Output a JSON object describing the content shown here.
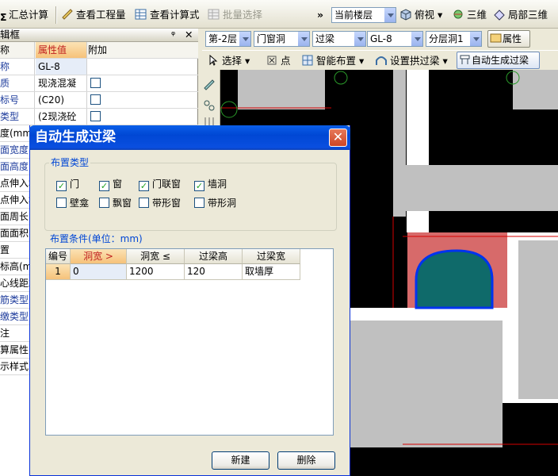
{
  "toolbar": {
    "summary_calc": "汇总计算",
    "view_quantity": "查看工程量",
    "view_formula": "查看计算式",
    "batch_select": "批量选择",
    "more": "»",
    "floor_select": "当前楼层",
    "view_mode": "俯视",
    "view_3d": "三维",
    "local_3d": "局部三维"
  },
  "toolbar2": {
    "floor": "第-2层",
    "category": "门窗洞",
    "element_type": "过梁",
    "element_name": "GL-8",
    "layer": "分层洞1",
    "property_btn": "属性",
    "select_btn": "选择",
    "point_btn": "点",
    "smart_layout_btn": "智能布置",
    "arch_beam_btn": "设置拱过梁",
    "auto_beam_btn": "自动生成过梁"
  },
  "left_panel": {
    "title": "辑框",
    "pin": "ᵠ",
    "close": "✕",
    "col_name": "称",
    "col_value": "属性值",
    "col_extra": "附加",
    "rows": [
      {
        "name": "称",
        "value": "GL-8",
        "check": false,
        "show_check": false,
        "blue": true
      },
      {
        "name": "质",
        "value": "现浇混凝",
        "check": false,
        "show_check": true,
        "blue": true
      },
      {
        "name": "标号",
        "value": "(C20)",
        "check": false,
        "show_check": true,
        "blue": true
      },
      {
        "name": "类型",
        "value": "(2现浇砼",
        "check": false,
        "show_check": true,
        "blue": true
      },
      {
        "name": "度(mm)",
        "value": "",
        "check": false,
        "show_check": false,
        "blue": false
      },
      {
        "name": "面宽度(",
        "value": "",
        "check": false,
        "show_check": false,
        "blue": true
      },
      {
        "name": "面高度(",
        "value": "",
        "check": false,
        "show_check": false,
        "blue": true
      },
      {
        "name": "点伸入墙",
        "value": "",
        "check": false,
        "show_check": false,
        "blue": false
      },
      {
        "name": "点伸入墙",
        "value": "",
        "check": false,
        "show_check": false,
        "blue": false
      },
      {
        "name": "面周长(",
        "value": "",
        "check": false,
        "show_check": false,
        "blue": false
      },
      {
        "name": "面面积(",
        "value": "",
        "check": false,
        "show_check": false,
        "blue": false
      },
      {
        "name": "置",
        "value": "",
        "check": false,
        "show_check": false,
        "blue": false
      },
      {
        "name": "标高(m)",
        "value": "",
        "check": false,
        "show_check": false,
        "blue": false
      },
      {
        "name": "心线距左",
        "value": "",
        "check": false,
        "show_check": false,
        "blue": false
      },
      {
        "name": "筋类型",
        "value": "",
        "check": false,
        "show_check": false,
        "blue": true
      },
      {
        "name": "缴类型",
        "value": "",
        "check": false,
        "show_check": false,
        "blue": true
      },
      {
        "name": "注",
        "value": "",
        "check": false,
        "show_check": false,
        "blue": false
      },
      {
        "name": "算属性",
        "value": "",
        "check": false,
        "show_check": false,
        "blue": false
      },
      {
        "name": "示样式",
        "value": "",
        "check": false,
        "show_check": false,
        "blue": false
      }
    ]
  },
  "dialog": {
    "title": "自动生成过梁",
    "close": "✕",
    "layout_type_label": "布置类型",
    "types": [
      {
        "label": "门",
        "checked": true
      },
      {
        "label": "窗",
        "checked": true
      },
      {
        "label": "门联窗",
        "checked": true
      },
      {
        "label": "墙洞",
        "checked": true
      },
      {
        "label": "壁龛",
        "checked": false
      },
      {
        "label": "飘窗",
        "checked": false
      },
      {
        "label": "带形窗",
        "checked": false
      },
      {
        "label": "带形洞",
        "checked": false
      }
    ],
    "conditions_label": "布置条件(单位：mm)",
    "columns": [
      "编号",
      "洞宽 >",
      "洞宽 ≤",
      "过梁高",
      "过梁宽"
    ],
    "rows": [
      {
        "id": "1",
        "width_gt": "0",
        "width_le": "1200",
        "beam_height": "120",
        "beam_width": "取墙厚"
      }
    ],
    "new_btn": "新建",
    "delete_btn": "删除"
  },
  "colors": {
    "title_bar": "#0a4fe0",
    "canvas_bg": "#000000",
    "wall_gray": "#c0c0c0",
    "opening_pink": "#d76a6a",
    "opening_teal": "#0f6a6a"
  }
}
